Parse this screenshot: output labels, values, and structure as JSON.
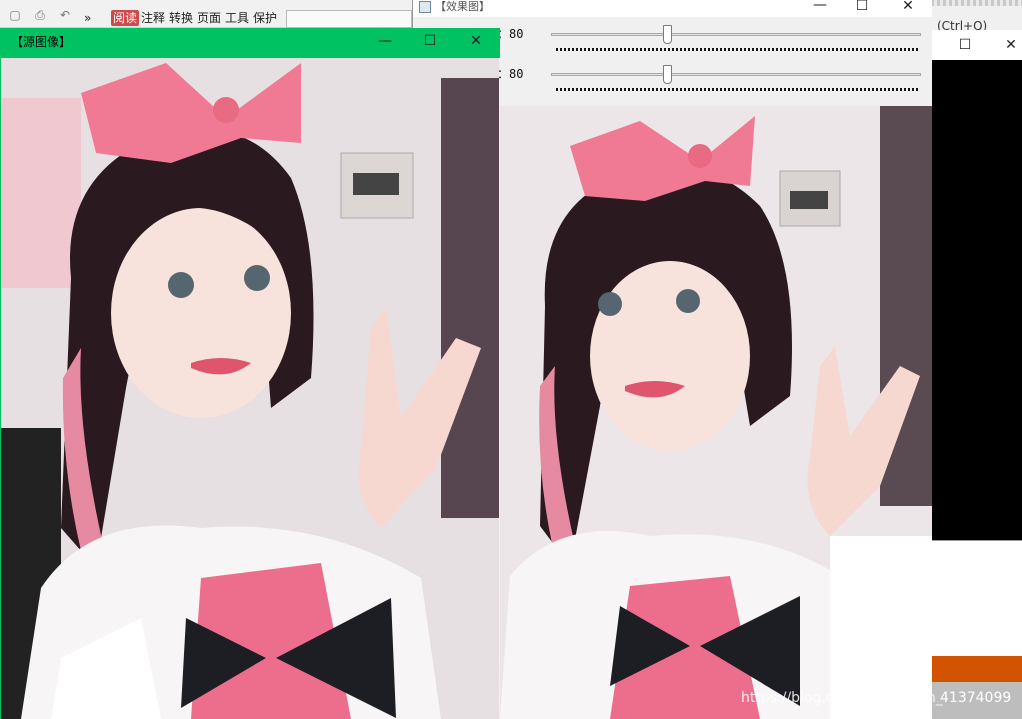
{
  "bg_app": {
    "menu": [
      "阅读",
      "注释",
      "转换",
      "页面",
      "工具",
      "保护"
    ],
    "more_glyph": "»",
    "search_hint": "(Ctrl+Q)"
  },
  "source_window": {
    "title": "【源图像】",
    "minimize_glyph": "—",
    "maximize_glyph": "☐",
    "close_glyph": "✕"
  },
  "effect_window": {
    "title": "【效果图】",
    "minimize_glyph": "—",
    "maximize_glyph": "☐",
    "close_glyph": "✕",
    "trackbars": [
      {
        "label": "：80",
        "value": 80
      },
      {
        "label": "：80",
        "value": 80
      }
    ]
  },
  "right_window": {
    "maximize_glyph": "☐",
    "close_glyph": "✕"
  },
  "watermark": {
    "url": "https://blog.csdn.net/weixin_",
    "id": "41374099"
  },
  "colors": {
    "source_titlebar": "#00c263",
    "ribbon_pink": "#f07a93",
    "orange_bar": "#d35400"
  }
}
